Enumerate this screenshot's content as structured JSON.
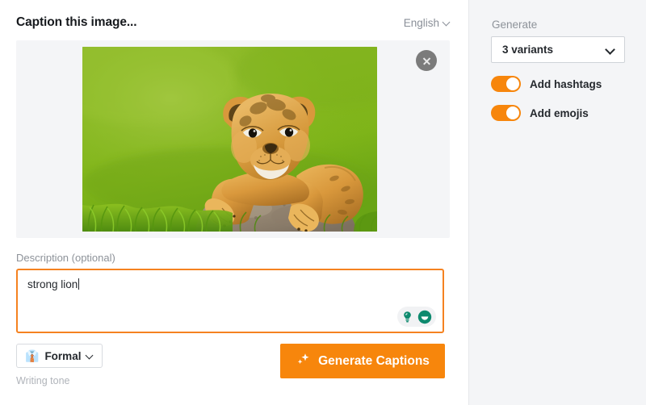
{
  "header": {
    "title": "Caption this image...",
    "language": "English",
    "language_chevron_icon": "chevron-down-icon"
  },
  "image_panel": {
    "close_icon": "close-icon",
    "photo_alt": "lion cub resting on a rock in green grass"
  },
  "description": {
    "label": "Description (optional)",
    "value": "strong lion",
    "placeholder": "",
    "tools": [
      {
        "icon": "lightbulb-icon",
        "name": "idea-suggestion-icon"
      },
      {
        "icon": "chat-bubble-icon",
        "name": "chat-assistant-icon"
      }
    ]
  },
  "footer": {
    "tone_emoji": "👔",
    "tone_label": "Formal",
    "tone_chevron_icon": "chevron-down-icon",
    "tone_caption": "Writing tone",
    "generate_icon": "sparkles-icon",
    "generate_label": "Generate Captions"
  },
  "side_panel": {
    "generate_label": "Generate",
    "variants_value": "3 variants",
    "variants_chevron_icon": "chevron-down-icon",
    "toggles": [
      {
        "label": "Add hashtags",
        "on": true
      },
      {
        "label": "Add emojis",
        "on": true
      }
    ]
  },
  "colors": {
    "accent_orange": "#f7860c",
    "focus_border": "#f58220",
    "panel_gray": "#f4f5f7",
    "text_dark": "#24282d",
    "text_muted": "#8d9299",
    "tool_teal": "#0e8a6e"
  }
}
